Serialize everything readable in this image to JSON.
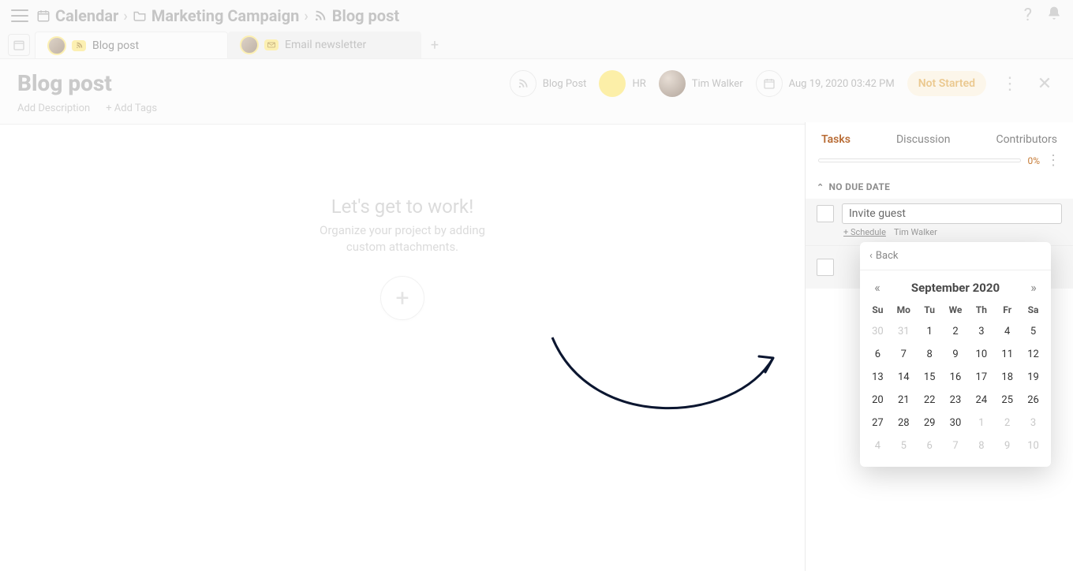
{
  "breadcrumb": {
    "root": "Calendar",
    "folder": "Marketing Campaign",
    "item": "Blog post"
  },
  "tabs": [
    {
      "label": "Blog post",
      "active": true
    },
    {
      "label": "Email newsletter",
      "active": false
    }
  ],
  "header": {
    "title": "Blog post",
    "addDescription": "Add Description",
    "addTags": "+ Add Tags"
  },
  "meta": {
    "type": "Blog Post",
    "dept": "HR",
    "owner": "Tim Walker",
    "datetime": "Aug 19, 2020 03:42 PM",
    "status": "Not Started"
  },
  "empty": {
    "title": "Let's get to work!",
    "line1": "Organize your project by adding",
    "line2": "custom attachments."
  },
  "panel": {
    "tabs": {
      "tasks": "Tasks",
      "discussion": "Discussion",
      "contributors": "Contributors"
    },
    "progressPct": "0%",
    "section": "NO DUE DATE",
    "taskValue": "Invite guest",
    "schedule": "+ Schedule",
    "assignee": "Tim Walker"
  },
  "picker": {
    "back": "Back",
    "month": "September 2020",
    "dows": [
      "Su",
      "Mo",
      "Tu",
      "We",
      "Th",
      "Fr",
      "Sa"
    ],
    "days": [
      {
        "n": "30",
        "m": true
      },
      {
        "n": "31",
        "m": true
      },
      {
        "n": "1"
      },
      {
        "n": "2"
      },
      {
        "n": "3"
      },
      {
        "n": "4"
      },
      {
        "n": "5"
      },
      {
        "n": "6"
      },
      {
        "n": "7"
      },
      {
        "n": "8"
      },
      {
        "n": "9"
      },
      {
        "n": "10"
      },
      {
        "n": "11"
      },
      {
        "n": "12"
      },
      {
        "n": "13"
      },
      {
        "n": "14"
      },
      {
        "n": "15"
      },
      {
        "n": "16"
      },
      {
        "n": "17"
      },
      {
        "n": "18"
      },
      {
        "n": "19"
      },
      {
        "n": "20"
      },
      {
        "n": "21"
      },
      {
        "n": "22"
      },
      {
        "n": "23"
      },
      {
        "n": "24"
      },
      {
        "n": "25"
      },
      {
        "n": "26"
      },
      {
        "n": "27"
      },
      {
        "n": "28"
      },
      {
        "n": "29"
      },
      {
        "n": "30"
      },
      {
        "n": "1",
        "m": true
      },
      {
        "n": "2",
        "m": true
      },
      {
        "n": "3",
        "m": true
      },
      {
        "n": "4",
        "m": true
      },
      {
        "n": "5",
        "m": true
      },
      {
        "n": "6",
        "m": true
      },
      {
        "n": "7",
        "m": true
      },
      {
        "n": "8",
        "m": true
      },
      {
        "n": "9",
        "m": true
      },
      {
        "n": "10",
        "m": true
      }
    ]
  }
}
